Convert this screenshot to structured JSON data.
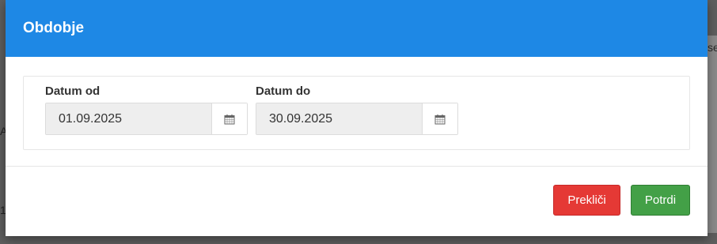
{
  "background": {
    "right_text": "se",
    "left_texts": [
      "A",
      "1"
    ]
  },
  "dialog": {
    "title": "Obdobje",
    "date_from": {
      "label": "Datum od",
      "value": "01.09.2025",
      "icon": "calendar-icon"
    },
    "date_to": {
      "label": "Datum do",
      "value": "30.09.2025",
      "icon": "calendar-icon"
    },
    "buttons": {
      "cancel": "Prekliči",
      "confirm": "Potrdi"
    }
  },
  "colors": {
    "header": "#1e88e5",
    "cancel": "#e53935",
    "confirm": "#43a047"
  }
}
